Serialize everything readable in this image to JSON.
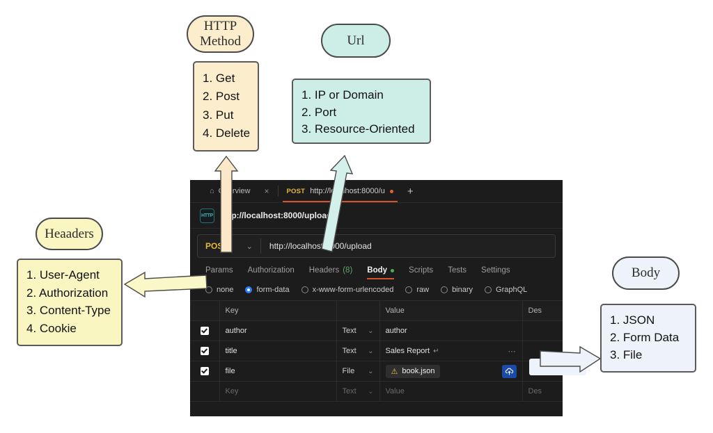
{
  "annotations": {
    "http_method": {
      "oval_label": "HTTP Method",
      "items": [
        "1. Get",
        "2. Post",
        "3. Put",
        "4. Delete"
      ],
      "color": "#fceecd"
    },
    "url": {
      "oval_label": "Url",
      "items": [
        "1. IP or Domain",
        "2. Port",
        "3. Resource-Oriented"
      ],
      "color": "#cdeee7"
    },
    "headers": {
      "oval_label": "Heaaders",
      "items": [
        "1. User-Agent",
        "2. Authorization",
        "3. Content-Type",
        "4. Cookie"
      ],
      "color": "#f9f6c2"
    },
    "body": {
      "oval_label": "Body",
      "items": [
        "1. JSON",
        "2. Form Data",
        "3. File"
      ],
      "color": "#eef3fb"
    }
  },
  "app": {
    "tabs": {
      "overview": {
        "label": "Overview",
        "home_icon": "home-icon",
        "close_icon": "×"
      },
      "request": {
        "method": "POST",
        "url": "http://localhost:8000/u",
        "unsaved_dot": true
      },
      "new_tab_icon": "+"
    },
    "breadcrumb": {
      "icon_label": "HTTP",
      "text": "http://localhost:8000/upload"
    },
    "urlbar": {
      "method": "POST",
      "method_chevron": "⌄",
      "url": "http://localhost:8000/upload"
    },
    "section_tabs": [
      {
        "label": "Params",
        "active": false
      },
      {
        "label": "Authorization",
        "active": false
      },
      {
        "label": "Headers",
        "count": "(8)",
        "active": false
      },
      {
        "label": "Body",
        "active": true,
        "dot": true
      },
      {
        "label": "Scripts",
        "active": false
      },
      {
        "label": "Tests",
        "active": false
      },
      {
        "label": "Settings",
        "active": false
      }
    ],
    "body_types": [
      {
        "label": "none",
        "selected": false
      },
      {
        "label": "form-data",
        "selected": true
      },
      {
        "label": "x-www-form-urlencoded",
        "selected": false
      },
      {
        "label": "raw",
        "selected": false
      },
      {
        "label": "binary",
        "selected": false
      },
      {
        "label": "GraphQL",
        "selected": false
      }
    ],
    "table": {
      "headers": {
        "key": "Key",
        "value": "Value",
        "description": "Des"
      },
      "rows": [
        {
          "checked": true,
          "key": "author",
          "type": "Text",
          "value": "author",
          "value_kind": "text"
        },
        {
          "checked": true,
          "key": "title",
          "type": "Text",
          "value": "Sales Report",
          "value_kind": "text",
          "return_glyph": "↵",
          "ellipsis": "⋯"
        },
        {
          "checked": true,
          "key": "file",
          "type": "File",
          "value": "book.json",
          "value_kind": "file",
          "warn_icon": "⚠",
          "upload_icon": "upload-cloud-icon"
        }
      ],
      "placeholder_row": {
        "key": "Key",
        "type": "Text",
        "value": "Value",
        "description": "Des"
      }
    }
  }
}
